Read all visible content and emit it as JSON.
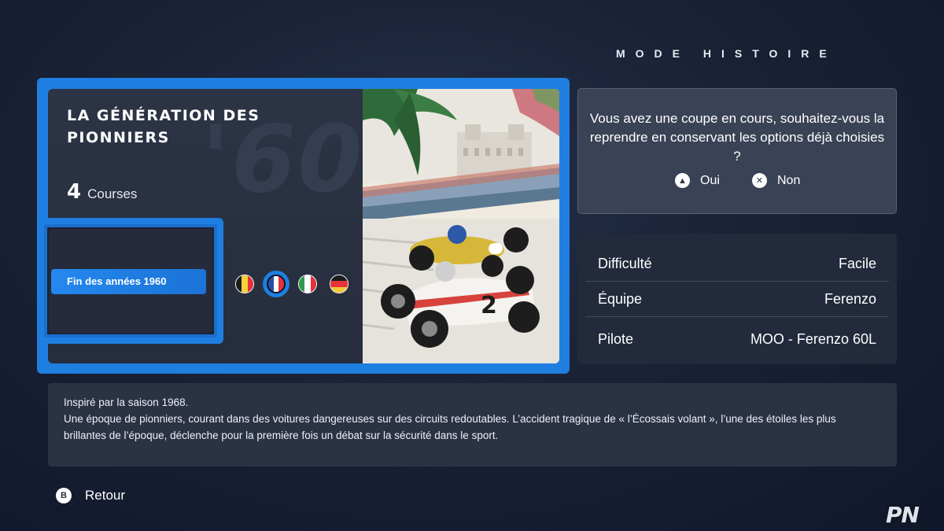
{
  "header": {
    "mode_title": "MODE HISTOIRE"
  },
  "card": {
    "title": "LA GÉNÉRATION DES PIONNIERS",
    "bg_year": "'60",
    "race_count": "4",
    "race_label": "Courses",
    "era_label": "Fin des années 1960",
    "flags": [
      {
        "name": "belgium-flag",
        "colors": [
          "#1b1b1b",
          "#f3d23a",
          "#e5323b"
        ],
        "orientation": "vertical",
        "selected": false
      },
      {
        "name": "france-flag",
        "colors": [
          "#2a4ea3",
          "#ffffff",
          "#e5323b"
        ],
        "orientation": "vertical",
        "selected": true
      },
      {
        "name": "italy-flag",
        "colors": [
          "#2f9a4b",
          "#ffffff",
          "#e5323b"
        ],
        "orientation": "vertical",
        "selected": false
      },
      {
        "name": "germany-flag",
        "colors": [
          "#1b1b1b",
          "#e5323b",
          "#f3c83a"
        ],
        "orientation": "horizontal",
        "selected": false
      }
    ]
  },
  "dialog": {
    "text": "Vous avez une coupe en cours, souhaitez-vous la reprendre en conservant les options déjà choisies ?",
    "yes_icon": "triangle-button-icon",
    "yes_label": "Oui",
    "no_icon": "cross-button-icon",
    "no_label": "Non"
  },
  "settings": [
    {
      "label": "Difficulté",
      "value": "Facile"
    },
    {
      "label": "Équipe",
      "value": "Ferenzo"
    },
    {
      "label": "Pilote",
      "value": "MOO - Ferenzo 60L"
    }
  ],
  "description": {
    "line1": "Inspiré par la saison 1968.",
    "line2": "Une époque de pionniers, courant dans des voitures dangereuses sur des circuits redoutables. L’accident tragique de « l’Écossais volant », l’une des étoiles les plus brillantes de l’époque, déclenche pour la première fois un débat sur la sécurité dans le sport."
  },
  "footer": {
    "back_icon": "b-button-icon",
    "back_label": "Retour"
  },
  "watermark": "PN",
  "colors": {
    "accent": "#1f7fe0",
    "panel": "#2c3445",
    "background": "#1a2236"
  }
}
